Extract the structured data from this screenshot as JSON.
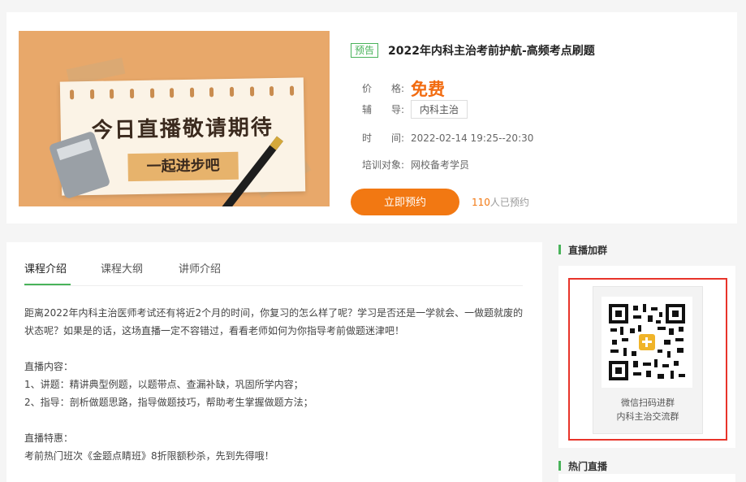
{
  "course": {
    "preview_tag": "预告",
    "title": "2022年内科主治考前护航-高频考点刷题",
    "price_label": "价　　格:",
    "price_value": "免费",
    "tutor_label": "辅　　导:",
    "tutor_value": "内科主治",
    "time_label": "时　　间:",
    "time_value": "2022-02-14 19:25--20:30",
    "target_label": "培训对象:",
    "target_value": "网校备考学员",
    "reserve_button": "立即预约",
    "reserve_count": "110",
    "reserve_suffix": "人已预约"
  },
  "banner": {
    "headline": "今日直播敬请期待",
    "subline": "一起进步吧"
  },
  "tabs": [
    {
      "label": "课程介绍",
      "active": true
    },
    {
      "label": "课程大纲",
      "active": false
    },
    {
      "label": "讲师介绍",
      "active": false
    }
  ],
  "intro": {
    "paragraph1": "距离2022年内科主治医师考试还有将近2个月的时间，你复习的怎么样了呢？学习是否还是一学就会、一做题就废的状态呢？如果是的话，这场直播一定不容错过，看看老师如何为你指导考前做题迷津吧！",
    "section1_title": "直播内容：",
    "item1": "1、讲题：精讲典型例题，以题带点、查漏补缺，巩固所学内容；",
    "item2": "2、指导：剖析做题思路，指导做题技巧，帮助考生掌握做题方法；",
    "section2_title": "直播特惠：",
    "promo": "考前热门班次《金题点睛班》8折限额秒杀，先到先得哦！"
  },
  "sidebar": {
    "group_title": "直播加群",
    "qr_caption1": "微信扫码进群",
    "qr_caption2": "内科主治交流群",
    "hot_title": "热门直播"
  },
  "colors": {
    "accent_green": "#49b35a",
    "accent_orange": "#f27812",
    "highlight_red": "#e8342a"
  }
}
